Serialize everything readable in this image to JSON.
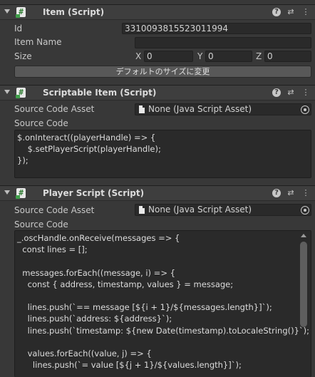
{
  "item_component": {
    "title": "Item (Script)",
    "id_label": "Id",
    "id_value": "3310093815523011994",
    "item_name_label": "Item Name",
    "item_name_value": "",
    "size_label": "Size",
    "size_x_label": "X",
    "size_x": "0",
    "size_y_label": "Y",
    "size_y": "0",
    "size_z_label": "Z",
    "size_z": "0",
    "default_size_button": "デフォルトのサイズに変更"
  },
  "scriptable_component": {
    "title": "Scriptable Item (Script)",
    "asset_label": "Source Code Asset",
    "asset_value": "None (Java Script Asset)",
    "source_label": "Source Code",
    "code": "$.onInteract((playerHandle) => {\n    $.setPlayerScript(playerHandle);\n});"
  },
  "player_component": {
    "title": "Player Script (Script)",
    "asset_label": "Source Code Asset",
    "asset_value": "None (Java Script Asset)",
    "source_label": "Source Code",
    "code": "_.oscHandle.onReceive(messages => {\n  const lines = [];\n\n  messages.forEach((message, i) => {\n    const { address, timestamp, values } = message;\n\n    lines.push(`== message [${i + 1}/${messages.length}]`);\n    lines.push(`address: ${address}`);\n    lines.push(`timestamp: ${new Date(timestamp).toLocaleString()}`);\n\n    values.forEach((value, j) => {\n      lines.push(`= value [${j + 1}/${values.length}]`);"
  },
  "header_icons": {
    "help": "?",
    "presets": "⇄",
    "menu": "⋮"
  }
}
